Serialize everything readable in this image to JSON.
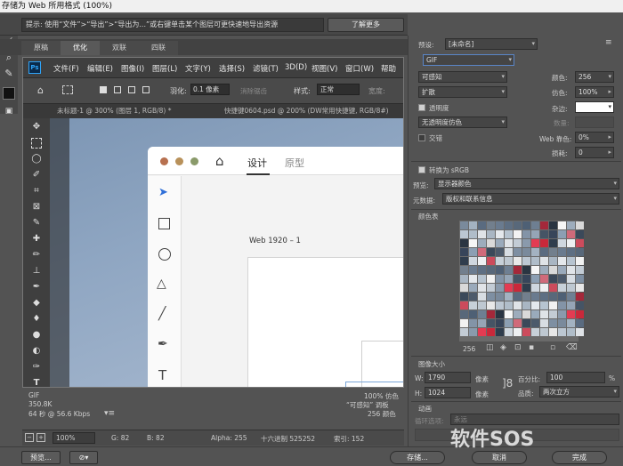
{
  "window": {
    "title": "存储为 Web 所用格式 (100%)"
  },
  "tip": {
    "text": "提示: 使用“文件”>“导出”>“导出为...”或右键单击某个图层可更快速地导出资源",
    "learn_more": "了解更多"
  },
  "view_tabs": [
    "原稿",
    "优化",
    "双联",
    "四联"
  ],
  "ps": {
    "menu": [
      "文件(F)",
      "编辑(E)",
      "图像(I)",
      "图层(L)",
      "文字(Y)",
      "选择(S)",
      "滤镜(T)",
      "3D(D)",
      "视图(V)",
      "窗口(W)",
      "帮助"
    ],
    "feather_label": "羽化:",
    "feather_value": "0.1 像素",
    "antialias": "消除锯齿",
    "style_label": "样式:",
    "style_value": "正常",
    "width_label": "宽度:",
    "doc_tabs": [
      "未标题-1 @ 300% (图层 1, RGB/8) *",
      "快捷键0604.psd @ 200% (DW常用快捷键, RGB/8#)"
    ]
  },
  "xd": {
    "tab_design": "设计",
    "tab_prototype": "原型",
    "artboard": "Web 1920 – 1"
  },
  "info": {
    "format": "GIF",
    "size": "350.8K",
    "time": "64 秒 @ 56.6 Kbps",
    "dither_pct": "100% 仿色",
    "palette": "“可感知” 调板",
    "colors": "256 颜色"
  },
  "status": {
    "zoom": "100%",
    "g": "G: 82",
    "b": "B: 82",
    "alpha": "Alpha: 255",
    "hex": "十六进制 525252",
    "index": "索引: 152"
  },
  "bottom": {
    "preview": "预览...",
    "save": "存储...",
    "cancel": "取消",
    "done": "完成"
  },
  "settings": {
    "preset_label": "预设:",
    "preset_value": "[未命名]",
    "format": "GIF",
    "reduction": "可感知",
    "dither_algo": "扩散",
    "colors_label": "颜色:",
    "colors_value": "256",
    "dither_label": "仿色:",
    "dither_value": "100%",
    "transparency_label": "透明度",
    "matte_label": "杂边:",
    "trans_dither": "无透明度仿色",
    "amount_label": "数量:",
    "interlaced_label": "交错",
    "web_snap_label": "Web 靠色:",
    "web_snap_value": "0%",
    "lossy_label": "损耗:",
    "lossy_value": "0",
    "convert_srgb": "转换为 sRGB",
    "preview_label": "预览:",
    "preview_value": "显示器颜色",
    "metadata_label": "元数据:",
    "metadata_value": "版权和联系信息",
    "color_table_label": "颜色表",
    "color_count": "256",
    "image_size_label": "图像大小",
    "w_label": "W:",
    "w_value": "1790",
    "h_label": "H:",
    "h_value": "1024",
    "px": "像素",
    "percent_label": "百分比:",
    "percent_value": "100",
    "pct_sign": "%",
    "quality_label": "品质:",
    "quality_value": "两次立方",
    "animation_label": "动画",
    "loop_label": "循环选项:",
    "loop_value": "永远"
  },
  "watermark": "软件SOS",
  "palette_colors": [
    "#7a8a9c",
    "#c9283a",
    "#8c9fb3",
    "#d9d9d9",
    "#b7c4d0",
    "#4e6075",
    "#e8e8e8",
    "#a3b2c1",
    "#2f3d4d",
    "#d06a7a",
    "#9aaabb",
    "#f2f2f2",
    "#6e7f92",
    "#bcc7d2",
    "#5a6b80",
    "#cfd7df",
    "#3b495a",
    "#e0e4e8",
    "#8394a7",
    "#a4283a",
    "#b0bdc9",
    "#727f8d",
    "#eef0f2",
    "#4c5a6b",
    "#c3ccd5",
    "#95a5b6",
    "#2a3542",
    "#dfe3e7",
    "#6a7b8f",
    "#cc4b5c",
    "#d7dde3",
    "#8a9aac",
    "#455465",
    "#f6f6f6",
    "#a9b6c3",
    "#5e6f83",
    "#c7d0d8",
    "#7e8fa2",
    "#e33b52",
    "#37455a",
    "#9dacbc",
    "#e4e8ec",
    "#58687a",
    "#bec8d1"
  ]
}
